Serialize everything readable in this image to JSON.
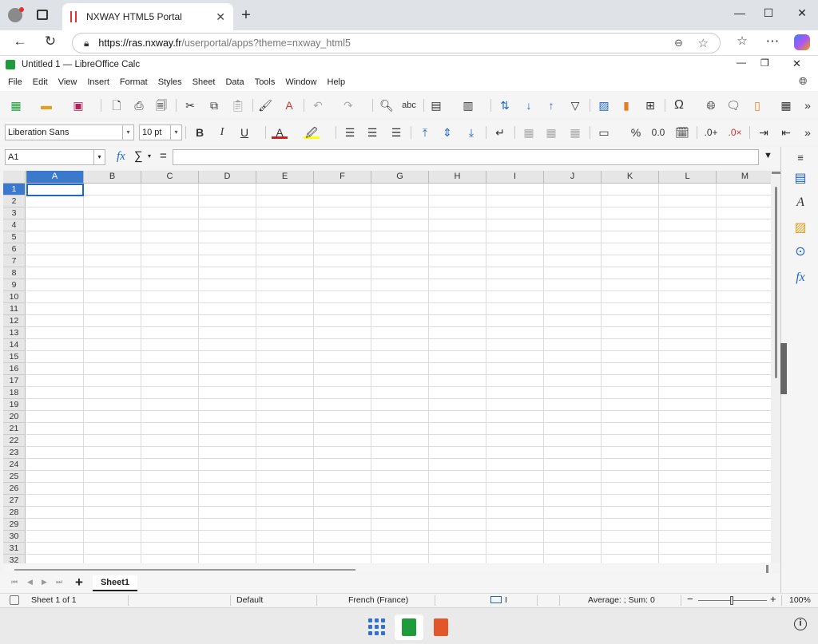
{
  "browser": {
    "tab_title": "NXWAY HTML5 Portal",
    "url_host": "https://ras.nxway.fr",
    "url_path": "/userportal/apps?theme=nxway_html5"
  },
  "window": {
    "title": "Untitled 1 — LibreOffice Calc"
  },
  "menu": [
    "File",
    "Edit",
    "View",
    "Insert",
    "Format",
    "Styles",
    "Sheet",
    "Data",
    "Tools",
    "Window",
    "Help"
  ],
  "formatting": {
    "font_name": "Liberation Sans",
    "font_size": "10 pt"
  },
  "formula_bar": {
    "cell_ref": "A1",
    "value": ""
  },
  "grid": {
    "columns": [
      "A",
      "B",
      "C",
      "D",
      "E",
      "F",
      "G",
      "H",
      "I",
      "J",
      "K",
      "L",
      "M"
    ],
    "rows": [
      "1",
      "2",
      "3",
      "4",
      "5",
      "6",
      "7",
      "8",
      "9",
      "10",
      "11",
      "12",
      "13",
      "14",
      "15",
      "16",
      "17",
      "18",
      "19",
      "20",
      "21",
      "22",
      "23",
      "24",
      "25",
      "26",
      "27",
      "28",
      "29",
      "30",
      "31",
      "32"
    ],
    "active_col": "A",
    "active_row": "1"
  },
  "sheets": {
    "add": "+",
    "tabs": [
      "Sheet1"
    ]
  },
  "status": {
    "sheet": "Sheet 1 of 1",
    "page_style": "Default",
    "language": "French (France)",
    "summary": "Average: ; Sum: 0",
    "zoom": "100%",
    "zoom_minus": "−",
    "zoom_plus": "+"
  },
  "colors": {
    "accent": "#3a79cc",
    "selection": "#1f66c9",
    "calc_green": "#1e9b3b",
    "impress_orange": "#e2572a"
  }
}
